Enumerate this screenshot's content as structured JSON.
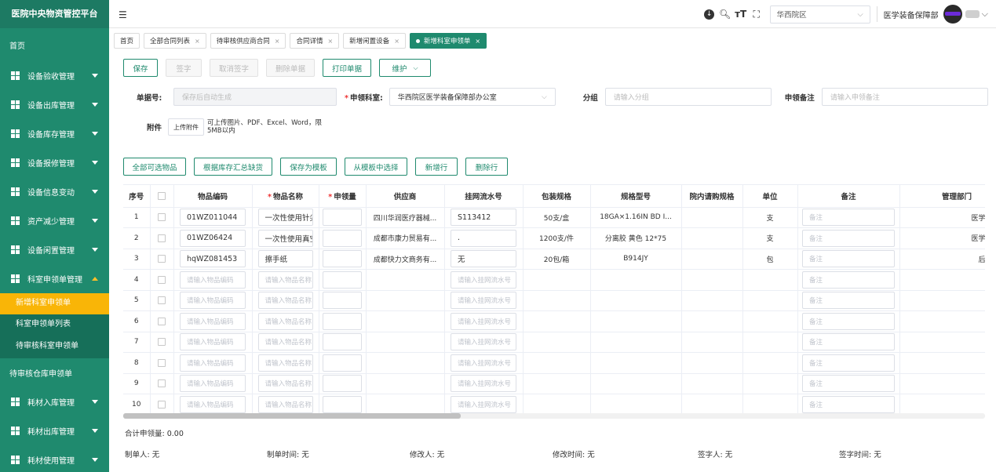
{
  "app": {
    "title": "医院中央物资管控平台"
  },
  "sidebar": {
    "home": "首页",
    "groups": [
      {
        "label": "设备验收管理"
      },
      {
        "label": "设备出库管理"
      },
      {
        "label": "设备库存管理"
      },
      {
        "label": "设备报修管理"
      },
      {
        "label": "设备信息变动"
      },
      {
        "label": "资产减少管理"
      },
      {
        "label": "设备闲置管理"
      },
      {
        "label": "科室申领单管理"
      }
    ],
    "subs": [
      "新增科室申领单",
      "科室申领单列表",
      "待审核科室申领单"
    ],
    "plain": "待审核仓库申领单",
    "groups2": [
      {
        "label": "耗材入库管理"
      },
      {
        "label": "耗材出库管理"
      },
      {
        "label": "耗材使用管理"
      }
    ]
  },
  "topbar": {
    "menu_icon": "menu-fold-icon",
    "campus": "华西院区",
    "dept": "医学装备保障部"
  },
  "tabs": [
    {
      "label": "首页"
    },
    {
      "label": "全部合同列表"
    },
    {
      "label": "待审核供应商合同"
    },
    {
      "label": "合同详情"
    },
    {
      "label": "新增闲置设备"
    },
    {
      "label": "新增科室申领单"
    }
  ],
  "toolbar": {
    "save": "保存",
    "sign": "签字",
    "unsign": "取消签字",
    "delete": "删除单据",
    "print": "打印单据",
    "maintain": "维护"
  },
  "form": {
    "doc_no_label": "单据号:",
    "doc_no_placeholder": "保存后自动生成",
    "dept_label": "申领科室:",
    "dept_value": "华西院区医学装备保障部办公室",
    "group_label": "分组",
    "group_placeholder": "请输入分组",
    "remark_label": "申领备注",
    "remark_placeholder": "请输入申领备注",
    "attach_label": "附件",
    "upload_btn": "上传附件",
    "upload_hint": "可上传图片、PDF、Excel、Word，限5MB以内"
  },
  "actions": {
    "all": "全部可选物品",
    "by_stock": "根据库存汇总缺货",
    "save_tpl": "保存为模板",
    "from_tpl": "从模板中选择",
    "add_row": "新增行",
    "del_row": "删除行"
  },
  "table": {
    "headers": [
      "序号",
      "",
      "物品编码",
      "物品名称",
      "申领量",
      "供应商",
      "挂网流水号",
      "包装规格",
      "规格型号",
      "院内请购规格",
      "单位",
      "备注",
      "管理部门"
    ],
    "code_placeholder": "请输入物品编码",
    "name_placeholder": "请输入物品名称",
    "serial_placeholder": "请输入挂网流水号",
    "remark_placeholder": "备注",
    "rows": [
      {
        "no": "1",
        "code": "01WZ011044",
        "name": "一次性使用针尖",
        "supplier": "四川华润医疗器械...",
        "serial": "S113412",
        "pack": "50支/盒",
        "model": "18GA×1.16IN BD I...",
        "unit": "支",
        "dept": "医学装备保障"
      },
      {
        "no": "2",
        "code": "01WZ06424",
        "name": "一次性使用真空",
        "supplier": "成都市康力贸易有...",
        "serial": ".",
        "pack": "1200支/件",
        "model": "分离胶 黄色 12*75",
        "unit": "支",
        "dept": "医学装备保障"
      },
      {
        "no": "3",
        "code": "hqWZ081453",
        "name": "擦手纸",
        "supplier": "成都快力文商务有...",
        "serial": "无",
        "pack": "20包/箱",
        "model": "B914JY",
        "unit": "包",
        "dept": "后勤管理部"
      },
      {
        "no": "4"
      },
      {
        "no": "5"
      },
      {
        "no": "6"
      },
      {
        "no": "7"
      },
      {
        "no": "8"
      },
      {
        "no": "9"
      },
      {
        "no": "10"
      }
    ]
  },
  "footer": {
    "total": "合计申领量:  0.00",
    "creator": "制单人: 无",
    "create_time": "制单时间: 无",
    "modifier": "修改人: 无",
    "modify_time": "修改时间: 无",
    "signer": "签字人: 无",
    "sign_time": "签字时间: 无"
  }
}
